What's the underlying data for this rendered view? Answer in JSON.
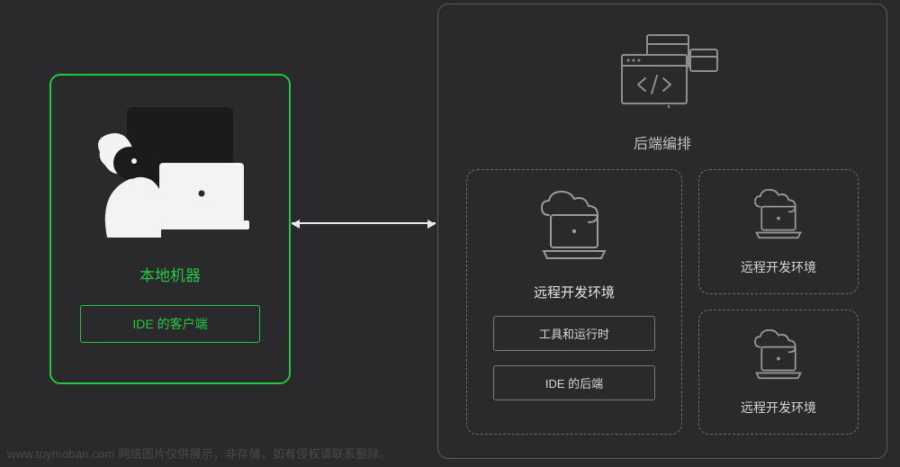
{
  "watermark": "www.toymoban.com 网络图片仅供展示，非存储，如有侵权请联系删除。",
  "left": {
    "title": "本地机器",
    "ide_client": "IDE 的客户端"
  },
  "right": {
    "orchestration_title": "后端编排",
    "main_rde": {
      "title": "远程开发环境",
      "tool_runtime": "工具和运行时",
      "ide_backend": "IDE 的后端"
    },
    "side_rde_1": "远程开发环境",
    "side_rde_2": "远程开发环境"
  },
  "icons": {
    "local_illustration": "person-laptop-illustration",
    "orchestration": "windows-code-icon",
    "cloud_laptop": "cloud-laptop-icon",
    "arrow": "double-arrow-icon"
  }
}
